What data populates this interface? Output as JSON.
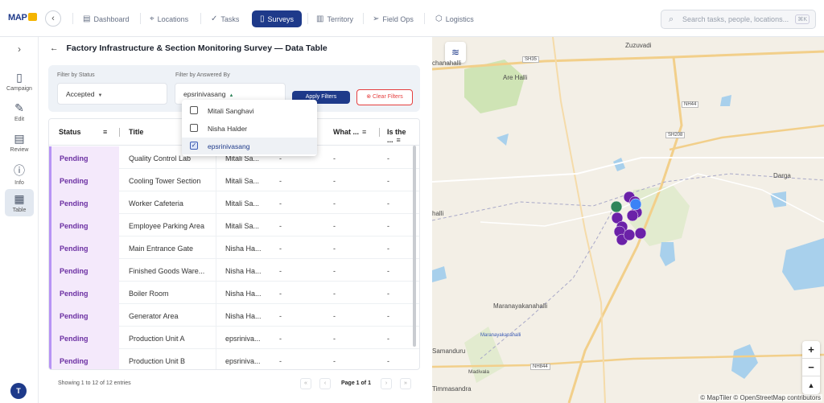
{
  "app": {
    "logo": "MAP"
  },
  "nav": {
    "items": [
      {
        "label": "Dashboard",
        "icon": "dashboard-icon"
      },
      {
        "label": "Locations",
        "icon": "location-pin-icon"
      },
      {
        "label": "Tasks",
        "icon": "check-icon"
      },
      {
        "label": "Surveys",
        "icon": "clipboard-icon",
        "active": true
      },
      {
        "label": "Territory",
        "icon": "map-icon"
      },
      {
        "label": "Field Ops",
        "icon": "send-icon"
      },
      {
        "label": "Logistics",
        "icon": "cube-icon"
      }
    ],
    "search_placeholder": "Search tasks, people, locations...",
    "search_shortcut": "⌘K"
  },
  "sidebar": {
    "items": [
      {
        "label": "Campaign",
        "icon": "clipboard-icon"
      },
      {
        "label": "Edit",
        "icon": "edit-icon"
      },
      {
        "label": "Review",
        "icon": "document-icon"
      },
      {
        "label": "Info",
        "icon": "info-icon"
      },
      {
        "label": "Table",
        "icon": "grid-icon",
        "active": true
      }
    ],
    "avatar_initial": "T"
  },
  "page": {
    "title": "Factory Infrastructure & Section Monitoring Survey — Data Table"
  },
  "filters": {
    "status_label": "Filter by Status",
    "status_value": "Accepted",
    "answered_label": "Filter by Answered By",
    "answered_value": "epsrinivasang",
    "apply_label": "Apply Filters",
    "clear_label": "Clear Filters",
    "dropdown_options": [
      {
        "label": "Mitali Sanghavi",
        "checked": false
      },
      {
        "label": "Nisha Halder",
        "checked": false
      },
      {
        "label": "epsrinivasang",
        "checked": true
      }
    ]
  },
  "table": {
    "headers": [
      "Status",
      "Title",
      "What ...",
      "Is the ..."
    ],
    "rows": [
      {
        "status": "Pending",
        "title": "Quality Control Lab",
        "by": "Mitali Sa...",
        "c3": "-",
        "c4": "-",
        "c5": "-"
      },
      {
        "status": "Pending",
        "title": "Cooling Tower Section",
        "by": "Mitali Sa...",
        "c3": "-",
        "c4": "-",
        "c5": "-"
      },
      {
        "status": "Pending",
        "title": "Worker Cafeteria",
        "by": "Mitali Sa...",
        "c3": "-",
        "c4": "-",
        "c5": "-"
      },
      {
        "status": "Pending",
        "title": "Employee Parking Area",
        "by": "Mitali Sa...",
        "c3": "-",
        "c4": "-",
        "c5": "-"
      },
      {
        "status": "Pending",
        "title": "Main Entrance Gate",
        "by": "Nisha Ha...",
        "c3": "-",
        "c4": "-",
        "c5": "-"
      },
      {
        "status": "Pending",
        "title": "Finished Goods Ware...",
        "by": "Nisha Ha...",
        "c3": "-",
        "c4": "-",
        "c5": "-"
      },
      {
        "status": "Pending",
        "title": "Boiler Room",
        "by": "Nisha Ha...",
        "c3": "-",
        "c4": "-",
        "c5": "-"
      },
      {
        "status": "Pending",
        "title": "Generator Area",
        "by": "Nisha Ha...",
        "c3": "-",
        "c4": "-",
        "c5": "-"
      },
      {
        "status": "Pending",
        "title": "Production Unit A",
        "by": "epsriniva...",
        "c3": "-",
        "c4": "-",
        "c5": "-"
      },
      {
        "status": "Pending",
        "title": "Production Unit B",
        "by": "epsriniva...",
        "c3": "-",
        "c4": "-",
        "c5": "-"
      }
    ],
    "footer": "Showing 1 to 12 of 12 entries",
    "page_label": "Page 1 of 1"
  },
  "map": {
    "labels": [
      "Zuzuvadi",
      "Are Halli",
      "chanahalli",
      "Darga",
      "halli",
      "Maranayakanahalli",
      "Maranayakanahalli",
      "Samanduru",
      "Madivala",
      "Timmasandra"
    ],
    "roads": [
      "SH35",
      "NH44",
      "SH208",
      "NH844"
    ],
    "attribution": "© MapTiler © OpenStreetMap contributors",
    "zoom_in": "+",
    "zoom_out": "−",
    "compass": "▲",
    "colors": {
      "marker_purple": "#6b21a8",
      "marker_green": "#2f855a",
      "marker_blue": "#3b82f6",
      "water": "#a8d0ec",
      "park": "#cfe4b5"
    }
  },
  "colors": {
    "brand": "#1e3a8a",
    "pending_bg": "#f4e9fb",
    "pending_text": "#6b2fa2",
    "danger": "#e53e3e"
  }
}
